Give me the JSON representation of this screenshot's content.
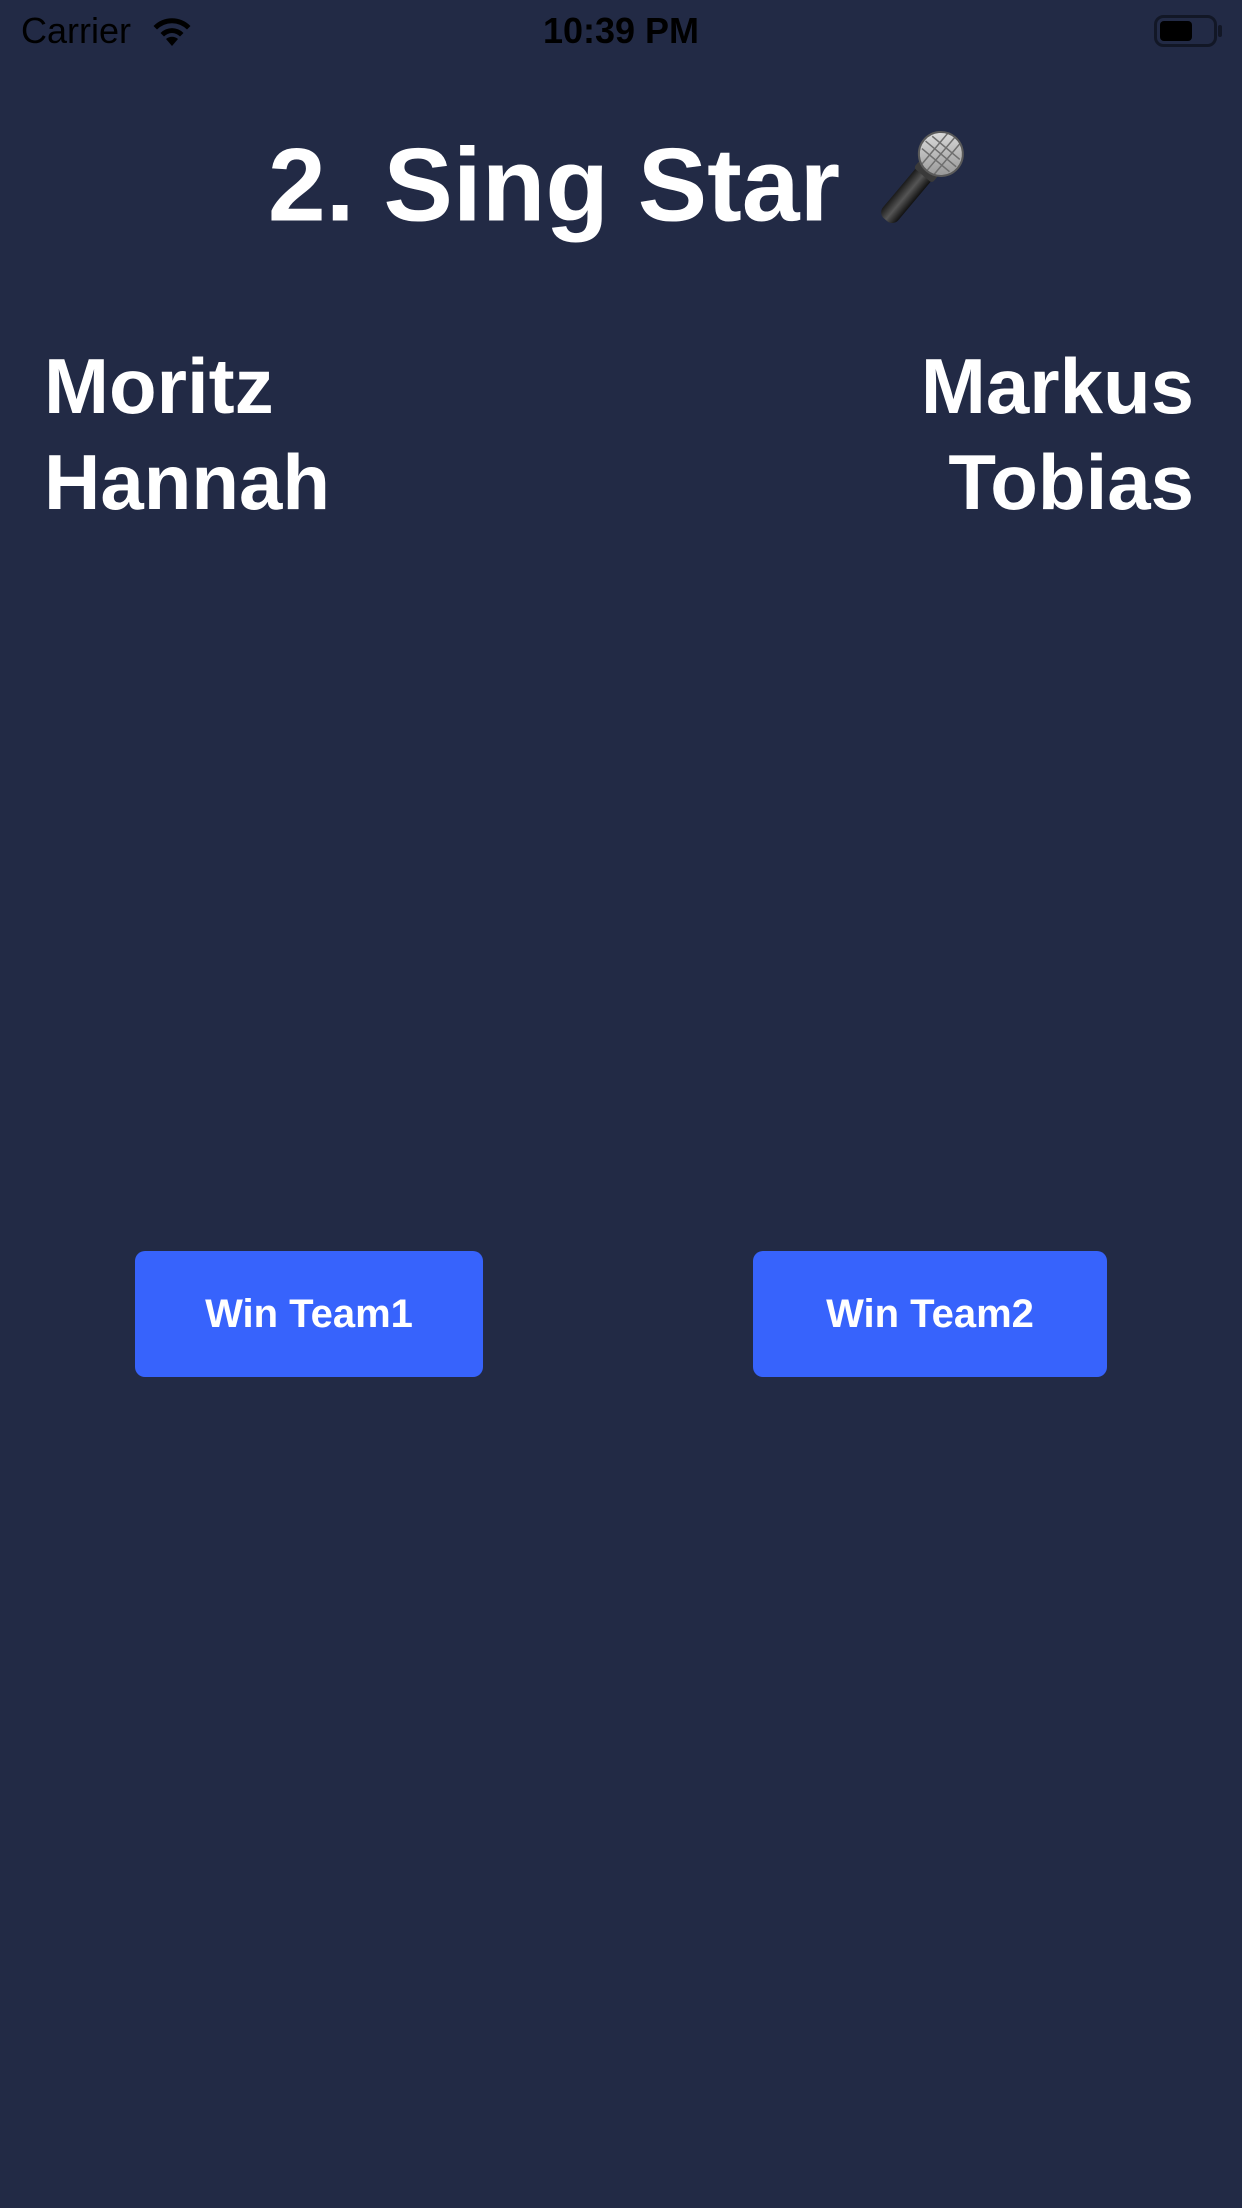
{
  "status_bar": {
    "carrier": "Carrier",
    "time": "10:39 PM",
    "wifi_icon": "wifi-icon",
    "battery_icon": "battery-icon"
  },
  "header": {
    "title": "2. Sing Star",
    "icon": "microphone-icon"
  },
  "teams": {
    "team1": {
      "players": [
        "Moritz",
        "Hannah"
      ]
    },
    "team2": {
      "players": [
        "Markus",
        "Tobias"
      ]
    }
  },
  "buttons": {
    "win_team1": "Win Team1",
    "win_team2": "Win Team2"
  },
  "colors": {
    "background": "#222a45",
    "button": "#3763fc",
    "text": "#ffffff"
  }
}
